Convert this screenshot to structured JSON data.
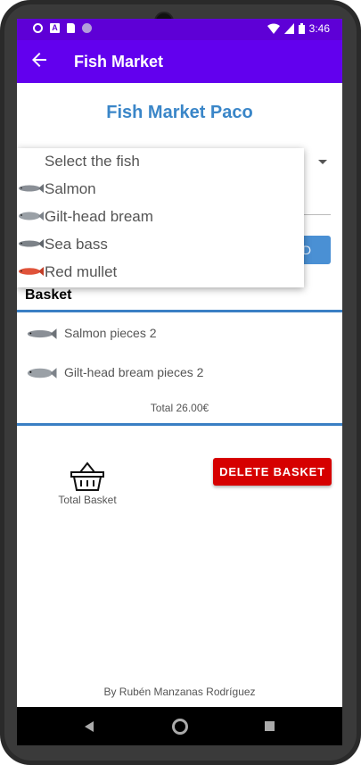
{
  "status_bar": {
    "time": "3:46",
    "left_icons": [
      "settings-icon",
      "a-notification-icon",
      "sd-card-icon",
      "dot-notification-icon"
    ],
    "right_icons": [
      "wifi-icon",
      "signal-icon",
      "battery-icon"
    ]
  },
  "app_bar": {
    "title": "Fish Market",
    "back_icon": "arrow-left-icon"
  },
  "header": {
    "title": "Fish Market Paco"
  },
  "dropdown": {
    "prompt": "Select the fish",
    "items": [
      {
        "label": "Salmon",
        "icon": "salmon-fish-icon",
        "color": "#8a8f96"
      },
      {
        "label": "Gilt-head bream",
        "icon": "bream-fish-icon",
        "color": "#9aa0a6"
      },
      {
        "label": "Sea bass",
        "icon": "seabass-fish-icon",
        "color": "#7c8288"
      },
      {
        "label": "Red mullet",
        "icon": "redmullet-fish-icon",
        "color": "#e0533a"
      }
    ]
  },
  "add_button": {
    "label": "D"
  },
  "basket": {
    "title": "Basket",
    "items": [
      {
        "label": "Salmon pieces 2",
        "icon": "salmon-fish-icon"
      },
      {
        "label": "Gilt-head bream pieces 2",
        "icon": "bream-fish-icon"
      }
    ],
    "total": "Total 26.00€"
  },
  "summary": {
    "icon": "basket-icon",
    "label": "Total Basket"
  },
  "delete_button": {
    "label": "DELETE BASKET"
  },
  "footer": {
    "text": "By Rubén Manzanas Rodríguez"
  },
  "nav_bar": {
    "icons": [
      "nav-back-icon",
      "nav-home-icon",
      "nav-recents-icon"
    ]
  },
  "colors": {
    "app_bar": "#6200ee",
    "status_bar": "#5e00d6",
    "accent_blue": "#3a86c8",
    "delete_red": "#d60000"
  }
}
